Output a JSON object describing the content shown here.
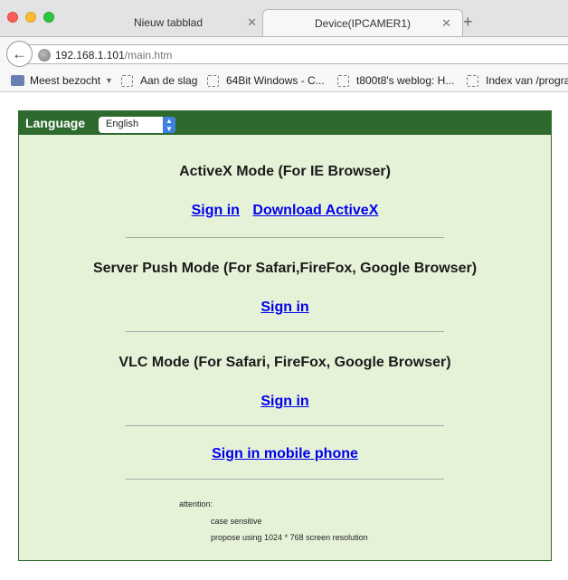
{
  "browser": {
    "tabs": [
      {
        "label": "Nieuw tabblad",
        "close": "✕"
      },
      {
        "label": "Device(IPCAMER1)",
        "close": "✕"
      }
    ],
    "new_tab": "+",
    "url_host": "192.168.1.101",
    "url_path": "/main.htm",
    "bookmarks": [
      "Meest bezocht",
      "Aan de slag",
      "64Bit Windows - C...",
      "t800t8's weblog: H...",
      "Index van /progra"
    ]
  },
  "page": {
    "language_label": "Language",
    "language_value": "English",
    "sections": [
      {
        "heading": "ActiveX Mode (For IE Browser)",
        "links": [
          "Sign in",
          "Download ActiveX"
        ]
      },
      {
        "heading": "Server Push Mode (For Safari,FireFox, Google Browser)",
        "links": [
          "Sign in"
        ]
      },
      {
        "heading": "VLC Mode (For Safari, FireFox, Google Browser)",
        "links": [
          "Sign in"
        ]
      }
    ],
    "mobile_link": "Sign in mobile phone",
    "attention_label": "attention:",
    "notes": [
      "case sensitive",
      "propose using 1024 * 768 screen resolution"
    ]
  },
  "colors": {
    "panel_bg": "#e6f2d8",
    "header_bar": "#2e6a2e",
    "link": "#0000ee"
  }
}
